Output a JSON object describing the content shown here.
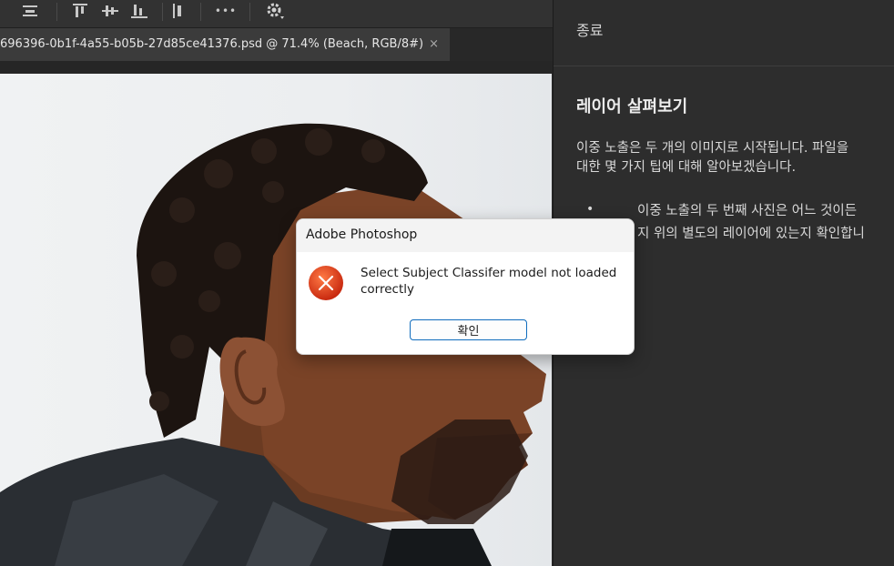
{
  "toolbar": {
    "icons": [
      "align-center-icon",
      "align-top-icon",
      "align-middle-icon",
      "align-bottom-icon",
      "distribute-icon",
      "more-icon",
      "gear-icon"
    ],
    "more_glyph": "•••"
  },
  "document_tab": {
    "title": "696396-0b1f-4a55-b05b-27d85ce41376.psd @ 71.4% (Beach, RGB/8#)",
    "close_glyph": "×"
  },
  "right_panel": {
    "header": "종료",
    "heading": "레이어 살펴보기",
    "paragraph_lines": [
      "이중 노출은 두 개의 이미지로 시작됩니다. 파일을",
      "대한 몇 가지 팁에 대해 알아보겠습니다."
    ],
    "bullet_glyph": "•",
    "bullet_lines": [
      "이중 노출의 두 번째 사진은 어느 것이든",
      "지 위의 별도의 레이어에 있는지 확인합니"
    ]
  },
  "dialog": {
    "title": "Adobe Photoshop",
    "message_lines": [
      "Select Subject Classifer model not loaded",
      "correctly"
    ],
    "ok_label": "확인",
    "icon": "error-icon",
    "icon_color": "#e03a1a"
  },
  "colors": {
    "toolbar_bg": "#323232",
    "panel_bg": "#2d2d2d",
    "dialog_button_border": "#0f6cbd"
  }
}
